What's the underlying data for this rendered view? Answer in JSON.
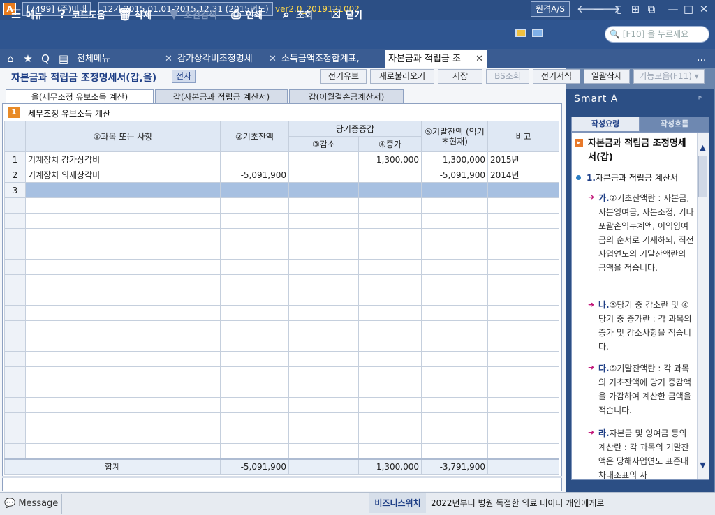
{
  "titlebar": {
    "logo": "A",
    "company": "[7499] (주)미래",
    "period": "12기 2015.01.01-2015.12.31 (2015년도)",
    "version": "ver2.0_2019121002",
    "remote": "원격A/S",
    "icons": [
      "back-arrow-icon",
      "forward-arrow-icon",
      "book-icon",
      "grid-icon",
      "window-icon",
      "minimize-icon",
      "maximize-icon",
      "close-icon"
    ]
  },
  "toolbar": {
    "menu": "메뉴",
    "help": "코드도움",
    "delete": "삭제",
    "filter": "조건검색",
    "print": "인쇄",
    "lookup": "조회",
    "close": "닫기",
    "search_placeholder": "[F10] 을 누르세요"
  },
  "tabbar": {
    "all_menu": "전체메뉴",
    "tabs": [
      "감가상각비조정명세",
      "소득금액조정합계표,",
      "자본금과 적립금 조"
    ],
    "more": "..."
  },
  "page": {
    "title": "자본금과 적립금 조정명세서(갑,을)",
    "badge": "전자",
    "buttons": [
      "전기유보",
      "새로불러오기",
      "저장",
      "BS조회",
      "전기서식",
      "일괄삭제",
      "기능모음(F11) ▾"
    ]
  },
  "subtabs": [
    "을(세무조정 유보소득 계산)",
    "갑(자본금과 적립금 계산서)",
    "갑(이월결손금계산서)"
  ],
  "section": {
    "num": "1",
    "title": "세무조정 유보소득 계산"
  },
  "table": {
    "headers": {
      "subject": "①과목 또는 사항",
      "begin": "②기초잔액",
      "change": "당기중증감",
      "decrease": "③감소",
      "increase": "④증가",
      "end": "⑤기말잔액 (익기초현재)",
      "note": "비고"
    },
    "rows": [
      {
        "no": "1",
        "subject": "기계장치 감가상각비",
        "begin": "",
        "decrease": "",
        "increase": "1,300,000",
        "end": "1,300,000",
        "note": "2015년"
      },
      {
        "no": "2",
        "subject": "기계장치 의제상각비",
        "begin": "-5,091,900",
        "decrease": "",
        "increase": "",
        "end": "-5,091,900",
        "note": "2014년"
      },
      {
        "no": "3",
        "subject": "",
        "begin": "",
        "decrease": "",
        "increase": "",
        "end": "",
        "note": ""
      }
    ],
    "total": {
      "label": "합계",
      "begin": "-5,091,900",
      "decrease": "",
      "increase": "1,300,000",
      "end": "-3,791,900",
      "note": ""
    }
  },
  "smart": {
    "title": "Smart A",
    "tab_guide": "작성요령",
    "tab_flow": "작성흐름",
    "guide_title": "자본금과 적립금 조정명세서(갑)",
    "h1_num": "1.",
    "h1_text": "자본금과 적립금 계산서",
    "items": [
      {
        "mark": "가.",
        "text": "②기초잔액란 : 자본금, 자본잉여금, 자본조정, 기타포괄손익누계액, 이익잉여금의 순서로 기재하되, 직전사업연도의 기말잔액란의 금액을 적습니다."
      },
      {
        "mark": "나.",
        "text": "③당기 중 감소란 및 ④당기 중 증가란 : 각 과목의 증가 및 감소사항을 적습니다."
      },
      {
        "mark": "다.",
        "text": "⑤기말잔액란 : 각 과목의 기초잔액에 당기 증감액을 가감하여 계산한 금액을 적습니다."
      },
      {
        "mark": "라.",
        "text": "자본금 및 잉여금 등의 계산란 : 각 과목의 기말잔액은 당해사업연도 표준대차대조표의 자"
      }
    ]
  },
  "status": {
    "message": "Message",
    "biz_label": "비즈니스위치",
    "biz_text": "2022년부터 병원 독점한 의료 데이터 개인에게로"
  }
}
